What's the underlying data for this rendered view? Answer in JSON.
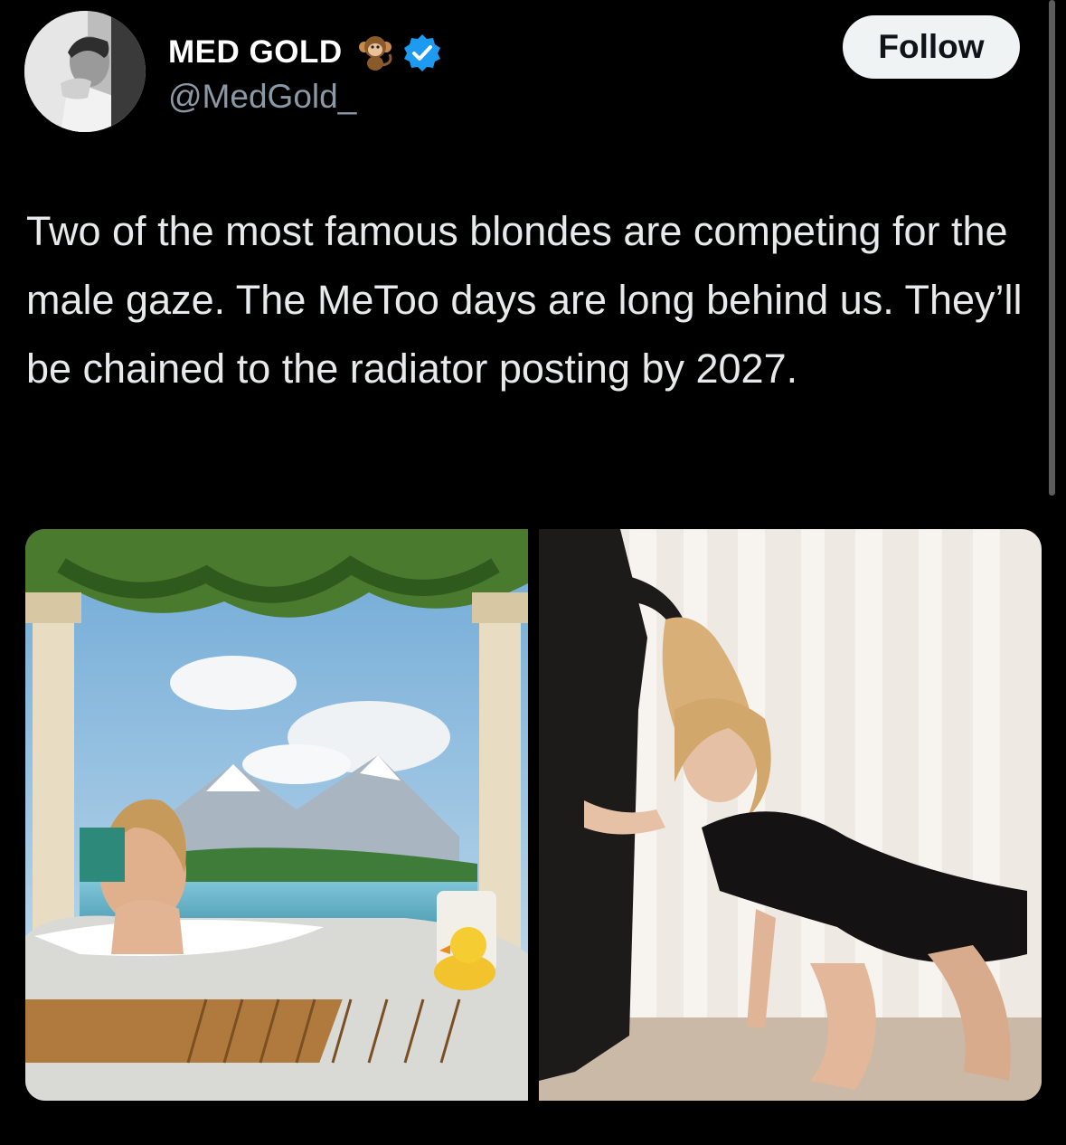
{
  "author": {
    "display_name": "MED GOLD",
    "handle": "@MedGold_",
    "name_emoji": "monkey-icon",
    "verified": true
  },
  "follow_label": "Follow",
  "tweet_text": "Two of the most famous blondes are competing for the male gaze. The MeToo days are long behind us. They’ll be chained to the radiator posting by 2027.",
  "media": {
    "count": 2
  },
  "colors": {
    "background": "#000000",
    "text": "#e7e9ea",
    "secondary_text": "#8b98a5",
    "verified_blue": "#1d9bf0",
    "follow_bg": "#eff3f4"
  }
}
